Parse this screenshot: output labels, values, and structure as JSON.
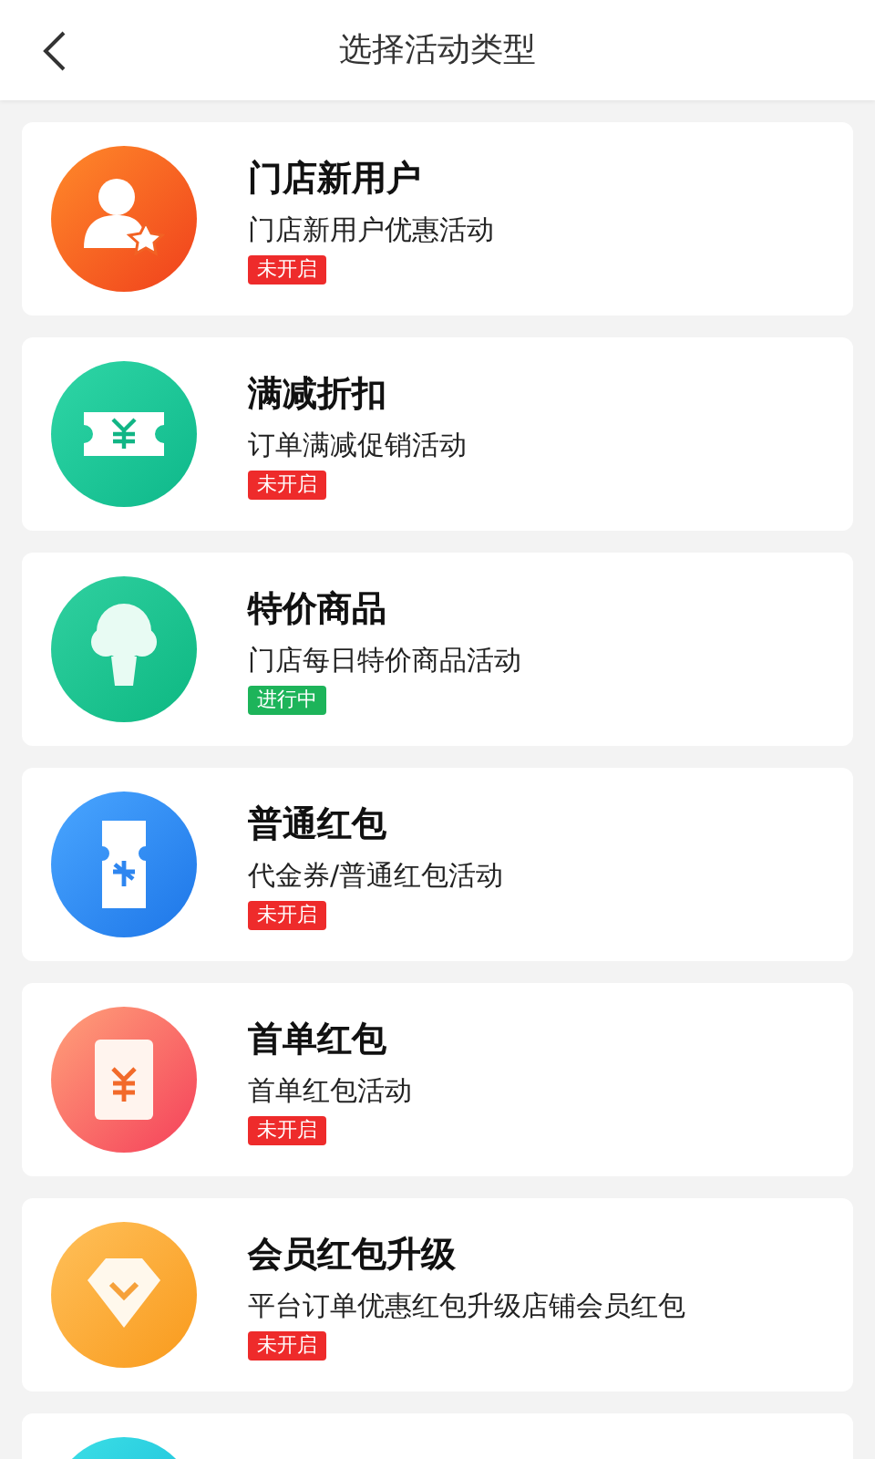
{
  "header": {
    "title": "选择活动类型"
  },
  "activities": [
    {
      "kind": "new-user",
      "title": "门店新用户",
      "subtitle": "门店新用户优惠活动",
      "status": "未开启",
      "active": false
    },
    {
      "kind": "discount",
      "title": "满减折扣",
      "subtitle": "订单满减促销活动",
      "status": "未开启",
      "active": false
    },
    {
      "kind": "special",
      "title": "特价商品",
      "subtitle": "门店每日特价商品活动",
      "status": "进行中",
      "active": true
    },
    {
      "kind": "coupon",
      "title": "普通红包",
      "subtitle": "代金券/普通红包活动",
      "status": "未开启",
      "active": false
    },
    {
      "kind": "first-order",
      "title": "首单红包",
      "subtitle": "首单红包活动",
      "status": "未开启",
      "active": false
    },
    {
      "kind": "member",
      "title": "会员红包升级",
      "subtitle": "平台订单优惠红包升级店铺会员红包",
      "status": "未开启",
      "active": false
    },
    {
      "kind": "delivery"
    }
  ]
}
